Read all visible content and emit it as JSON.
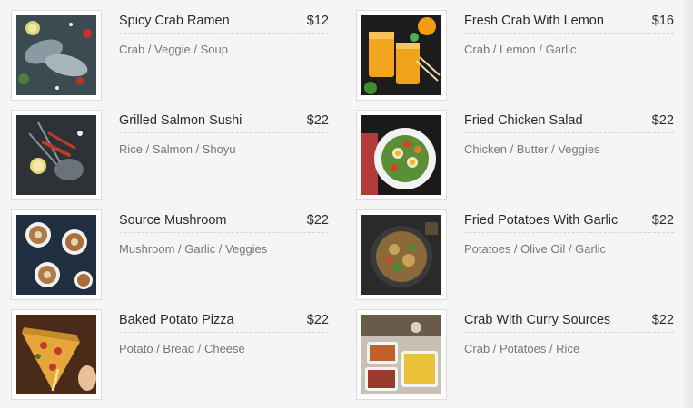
{
  "menu": {
    "items": [
      {
        "title": "Spicy Crab Ramen",
        "price": "$12",
        "desc": "Crab / Veggie / Soup"
      },
      {
        "title": "Fresh Crab With Lemon",
        "price": "$16",
        "desc": "Crab / Lemon / Garlic"
      },
      {
        "title": "Grilled Salmon Sushi",
        "price": "$22",
        "desc": "Rice / Salmon / Shoyu"
      },
      {
        "title": "Fried Chicken Salad",
        "price": "$22",
        "desc": "Chicken / Butter / Veggies"
      },
      {
        "title": "Source Mushroom",
        "price": "$22",
        "desc": "Mushroom / Garlic / Veggies"
      },
      {
        "title": "Fried Potatoes With Garlic",
        "price": "$22",
        "desc": "Potatoes / Olive Oil / Garlic"
      },
      {
        "title": "Baked Potato Pizza",
        "price": "$22",
        "desc": "Potato / Bread / Cheese"
      },
      {
        "title": "Crab With Curry Sources",
        "price": "$22",
        "desc": "Crab / Potatoes / Rice"
      }
    ]
  }
}
